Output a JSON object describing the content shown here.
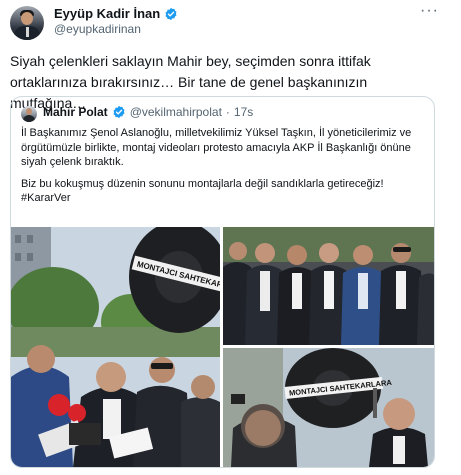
{
  "post": {
    "author": {
      "display_name": "Eyyüp Kadir İnan",
      "handle": "@eyupkadirinan",
      "avatar_icon": "profile-photo",
      "verified_icon": "verified-badge-icon",
      "verified_color": "#1d9bf0"
    },
    "more_label": "···",
    "text": "Siyah çelenkleri saklayın Mahir bey, seçimden sonra ittifak ortaklarınıza bırakırsınız… Bir tane de genel başkanınızın mutfağına…",
    "quoted": {
      "author": {
        "display_name": "Mahir Polat",
        "handle": "@vekilmahirpolat",
        "separator": "·",
        "time": "17s"
      },
      "paragraph1": "İl Başkanımız Şenol Aslanoğlu, milletvekilimiz Yüksel Taşkın, İl yöneticilerimiz ve örgütümüzle birlikte, montaj videoları protesto amacıyla AKP İl Başkanlığı önüne siyah çelenk bıraktık.",
      "paragraph2": "Biz bu kokuşmuş düzenin sonunu montajlarla değil sandıklarla getireceğiz!",
      "hashtag": "#KararVer",
      "media": [
        {
          "name": "photo-wreath-press-statement",
          "banner_text": "MONTAJCI SAHTEKARLARA"
        },
        {
          "name": "photo-group-standing",
          "banner_text": ""
        },
        {
          "name": "photo-wreath-closeup",
          "banner_text": "MONTAJCI SAHTEKARLARA"
        }
      ]
    }
  }
}
